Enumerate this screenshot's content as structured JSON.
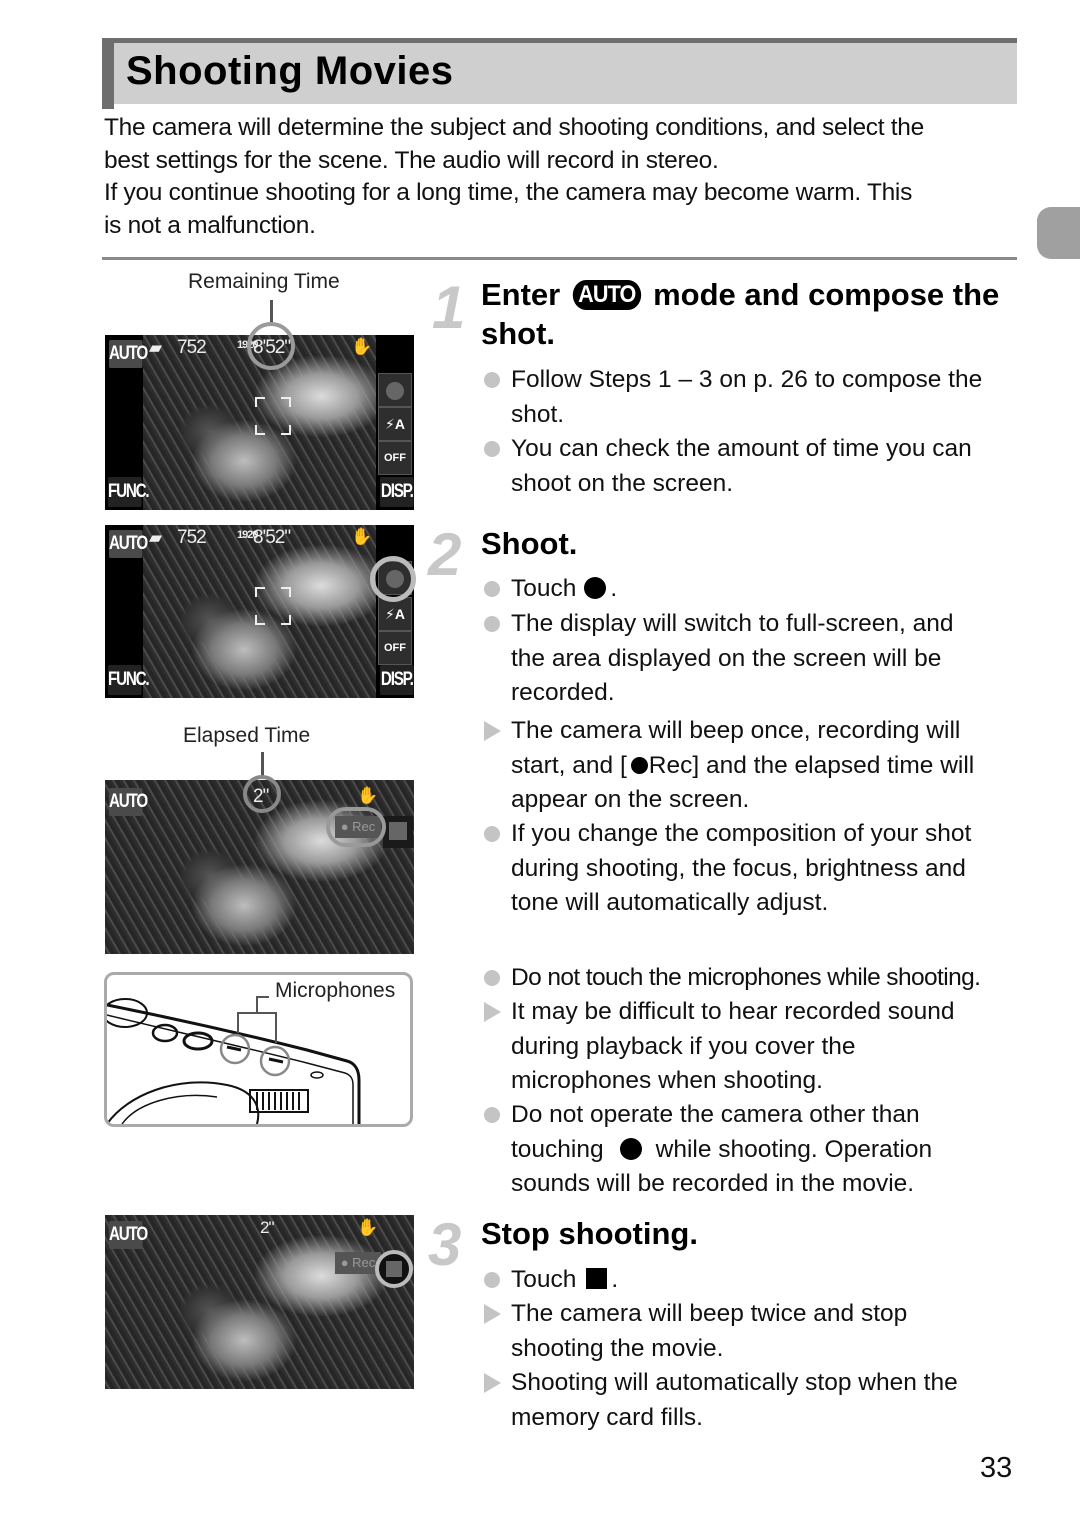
{
  "page": {
    "title": "Shooting Movies",
    "intro_lines": [
      "The camera will determine the subject and shooting conditions, and select the",
      "best settings for the scene. The audio will record in stereo.",
      "If you continue shooting for a long time, the camera may become warm. This",
      "is not a malfunction."
    ],
    "page_number": "33"
  },
  "figures": {
    "remaining_time_label": "Remaining Time",
    "elapsed_time_label": "Elapsed Time",
    "microphones_label": "Microphones",
    "screen": {
      "mode": "AUTO",
      "shots": "752",
      "remaining_time": "8'52\"",
      "elapsed_time": "2\"",
      "func_label": "FUNC.",
      "disp_label": "DISP.",
      "flash_label": "⚡A",
      "off_label": "OFF",
      "rec_label": "● Rec",
      "res_label": "1920"
    }
  },
  "steps": [
    {
      "number": "1",
      "title_pre": "Enter",
      "title_badge": "AUTO",
      "title_post": "mode and compose the",
      "title_line2": "shot.",
      "items": [
        {
          "type": "bullet",
          "lines": [
            "Follow Steps 1 – 3 on p. 26 to compose the",
            "shot."
          ]
        },
        {
          "type": "bullet",
          "lines": [
            "You can check the amount of time you can",
            "shoot on the screen."
          ]
        }
      ]
    },
    {
      "number": "2",
      "title": "Shoot.",
      "items": [
        {
          "type": "bullet",
          "pre": "Touch",
          "icon": "record-button",
          "post": "."
        },
        {
          "type": "bullet",
          "lines": [
            "The display will switch to full-screen, and",
            "the area displayed on the screen will be",
            "recorded."
          ]
        },
        {
          "type": "result",
          "line1": "The camera will beep once, recording will",
          "line2_pre": "start, and [",
          "line2_icon": "record-dot",
          "line2_post": "Rec] and the elapsed time will",
          "line3": "appear on the screen."
        },
        {
          "type": "bullet",
          "lines": [
            "If you change the composition of your shot",
            "during shooting, the focus, brightness and",
            "tone will automatically adjust."
          ]
        },
        {
          "type": "bullet",
          "lines": [
            "Do not touch the microphones while shooting."
          ]
        },
        {
          "type": "result",
          "lines": [
            "It may be difficult to hear recorded sound",
            "during playback if you cover the",
            "microphones when shooting."
          ]
        },
        {
          "type": "bullet",
          "line1": "Do not operate the camera other than",
          "line2_pre": "touching",
          "line2_icon": "record-button",
          "line2_post": "while shooting. Operation",
          "line3": "sounds will be recorded in the movie."
        }
      ]
    },
    {
      "number": "3",
      "title": "Stop shooting.",
      "items": [
        {
          "type": "bullet",
          "pre": "Touch",
          "icon": "stop-button",
          "post": "."
        },
        {
          "type": "result",
          "lines": [
            "The camera will beep twice and stop",
            "shooting the movie."
          ]
        },
        {
          "type": "result",
          "lines": [
            "Shooting will automatically stop when the",
            "memory card fills."
          ]
        }
      ]
    }
  ],
  "colors": {
    "title_bar_bg": "#cfcfcf",
    "title_bar_accent": "#6e6e6e",
    "step_number": "#c8c8c8",
    "bullet": "#c4c4c4",
    "side_tab": "#a0a0a0"
  }
}
